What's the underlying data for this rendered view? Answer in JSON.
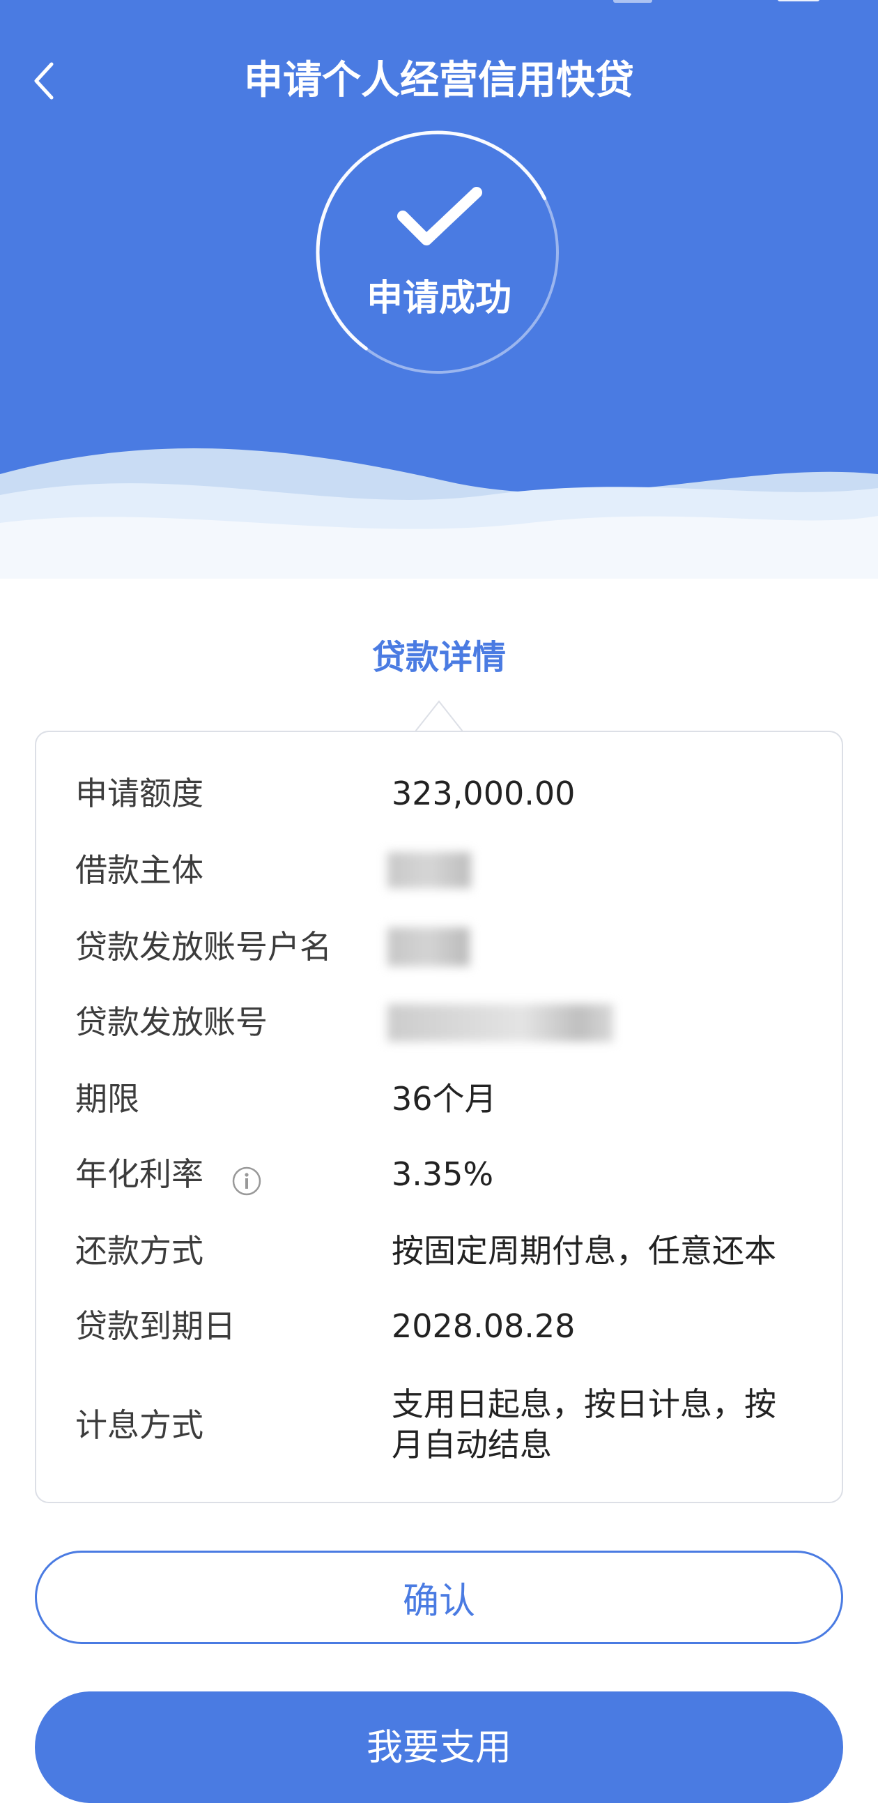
{
  "header": {
    "title": "申请个人经营信用快贷",
    "back_icon": "chevron-left-icon",
    "background_color": "#4a7be2"
  },
  "status": {
    "icon": "check-icon",
    "text": "申请成功"
  },
  "section": {
    "title": "贷款详情"
  },
  "details": {
    "rows": [
      {
        "label": "申请额度",
        "value": "323,000.00"
      },
      {
        "label": "借款主体",
        "value": "",
        "redacted": true
      },
      {
        "label": "贷款发放账号户名",
        "value": "",
        "redacted": true
      },
      {
        "label": "贷款发放账号",
        "value": "",
        "redacted": true
      },
      {
        "label": "期限",
        "value": "36个月"
      },
      {
        "label": "年化利率",
        "value": "3.35%",
        "info_icon": "info-icon"
      },
      {
        "label": "还款方式",
        "value": "按固定周期付息，任意还本"
      },
      {
        "label": "贷款到期日",
        "value": "2028.08.28"
      },
      {
        "label": "计息方式",
        "value_line1": "支用日起息，按日计息，按",
        "value_line2": "月自动结息"
      }
    ]
  },
  "actions": {
    "confirm_label": "确认",
    "use_label": "我要支用"
  },
  "colors": {
    "primary": "#4a7be2",
    "card_border": "#dcdfe6"
  }
}
